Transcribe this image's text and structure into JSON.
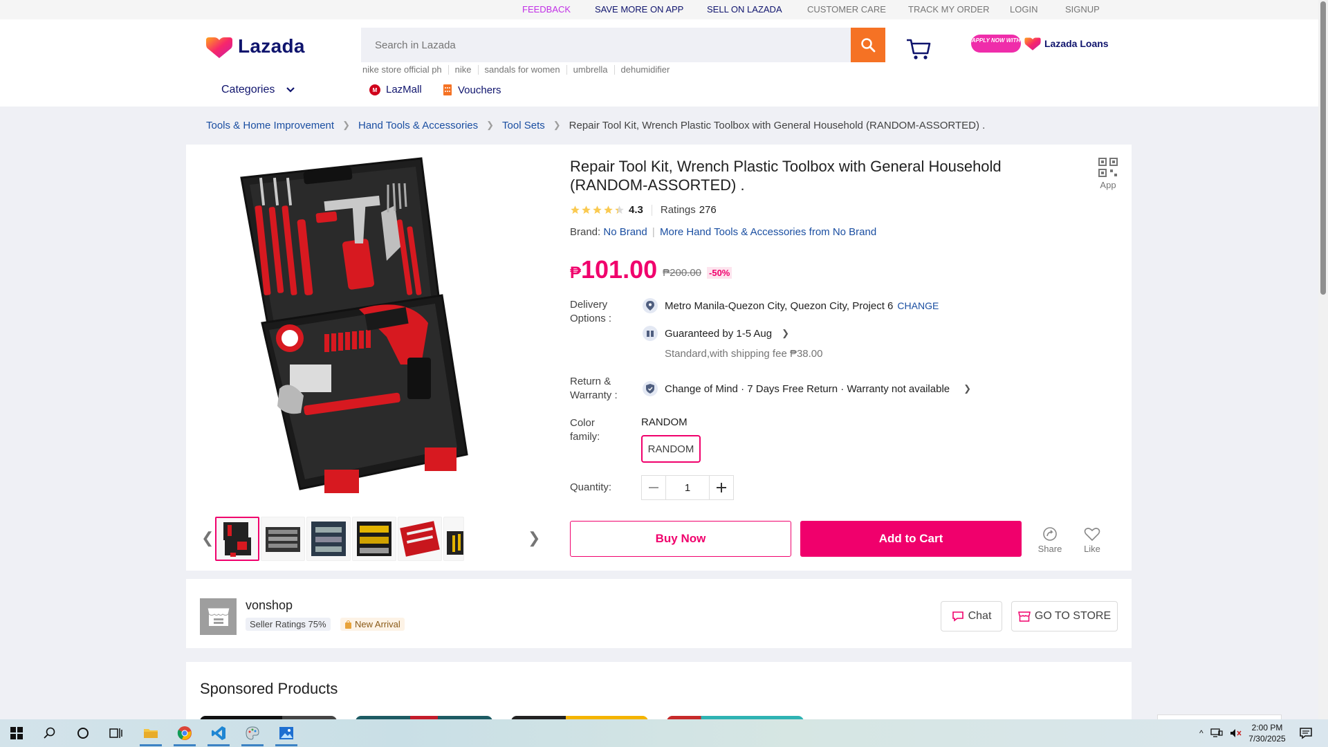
{
  "topbar": {
    "links": [
      "FEEDBACK",
      "SAVE MORE ON APP",
      "SELL ON LAZADA",
      "CUSTOMER CARE",
      "TRACK MY ORDER",
      "LOGIN",
      "SIGNUP"
    ],
    "colors": {
      "feedback": "#c12fe6",
      "highlight": "#0f146d",
      "muted": "#757575"
    }
  },
  "header": {
    "logo_text": "Lazada",
    "search_placeholder": "Search in Lazada",
    "suggestions": [
      "nike store official ph",
      "nike",
      "sandals for women",
      "umbrella",
      "dehumidifier"
    ],
    "apply_pill": "APPLY NOW WITH",
    "loans_label": "Lazada Loans",
    "categories_label": "Categories",
    "lazmall_label": "LazMall",
    "vouchers_label": "Vouchers"
  },
  "breadcrumb": {
    "items": [
      "Tools & Home Improvement",
      "Hand Tools & Accessories",
      "Tool Sets"
    ],
    "current": "Repair Tool Kit, Wrench Plastic Toolbox with General Household (RANDOM-ASSORTED) ."
  },
  "product": {
    "title": "Repair Tool Kit, Wrench Plastic Toolbox with General Household (RANDOM-ASSORTED) .",
    "app_label": "App",
    "rating_value": "4.3",
    "rating_stars": 4.3,
    "ratings_label": "Ratings",
    "ratings_count": "276",
    "brand_label": "Brand:",
    "brand_value": "No Brand",
    "more_from": "More Hand Tools & Accessories from No Brand",
    "currency": "₱",
    "price": "101.00",
    "original_price": "₱200.00",
    "discount": "-50%",
    "delivery_label": "Delivery Options :",
    "location": "Metro Manila-Quezon City, Quezon City, Project 6",
    "change_label": "CHANGE",
    "guaranteed": "Guaranteed by 1-5 Aug",
    "shipping": "Standard,with shipping fee ₱38.00",
    "return_label": "Return & Warranty :",
    "return_text": "Change of Mind · 7 Days Free Return · Warranty not available",
    "color_label": "Color family:",
    "color_value": "RANDOM",
    "color_option": "RANDOM",
    "quantity_label": "Quantity:",
    "quantity": "1",
    "buy_now": "Buy Now",
    "add_to_cart": "Add to Cart",
    "share_label": "Share",
    "like_label": "Like",
    "accent_color": "#f0006c"
  },
  "seller": {
    "name": "vonshop",
    "ratings_badge": "Seller Ratings 75%",
    "arrival_badge": "New Arrival",
    "chat_label": "Chat",
    "store_label": "GO TO STORE"
  },
  "sponsored": {
    "title": "Sponsored Products"
  },
  "taskbar": {
    "time": "2:00 PM",
    "date": "7/30/2025"
  }
}
